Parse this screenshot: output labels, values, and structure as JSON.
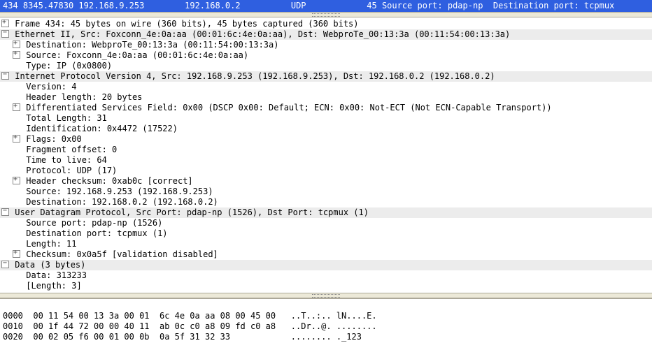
{
  "summary": {
    "no": "434",
    "time": "8345.47830",
    "source": "192.168.9.253",
    "destination": "192.168.0.2",
    "protocol": "UDP",
    "length": "45",
    "info": "Source port: pdap-np  Destination port: tcpmux"
  },
  "frame": "Frame 434: 45 bytes on wire (360 bits), 45 bytes captured (360 bits)",
  "eth": {
    "title": "Ethernet II, Src: Foxconn_4e:0a:aa (00:01:6c:4e:0a:aa), Dst: WebproTe_00:13:3a (00:11:54:00:13:3a)",
    "dst": "Destination: WebproTe_00:13:3a (00:11:54:00:13:3a)",
    "src": "Source: Foxconn_4e:0a:aa (00:01:6c:4e:0a:aa)",
    "type": "Type: IP (0x0800)"
  },
  "ip": {
    "title": "Internet Protocol Version 4, Src: 192.168.9.253 (192.168.9.253), Dst: 192.168.0.2 (192.168.0.2)",
    "version": "Version: 4",
    "hlen": "Header length: 20 bytes",
    "dsf": "Differentiated Services Field: 0x00 (DSCP 0x00: Default; ECN: 0x00: Not-ECT (Not ECN-Capable Transport))",
    "tlen": "Total Length: 31",
    "id": "Identification: 0x4472 (17522)",
    "flags": "Flags: 0x00",
    "frag": "Fragment offset: 0",
    "ttl": "Time to live: 64",
    "proto": "Protocol: UDP (17)",
    "chk": "Header checksum: 0xab0c [correct]",
    "src": "Source: 192.168.9.253 (192.168.9.253)",
    "dst": "Destination: 192.168.0.2 (192.168.0.2)"
  },
  "udp": {
    "title": "User Datagram Protocol, Src Port: pdap-np (1526), Dst Port: tcpmux (1)",
    "sport": "Source port: pdap-np (1526)",
    "dport": "Destination port: tcpmux (1)",
    "len": "Length: 11",
    "chk": "Checksum: 0x0a5f [validation disabled]"
  },
  "data": {
    "title": "Data (3 bytes)",
    "data": "Data: 313233",
    "length": "[Length: 3]"
  },
  "hex": {
    "l0": "0000  00 11 54 00 13 3a 00 01  6c 4e 0a aa 08 00 45 00   ..T..:.. lN....E.",
    "l1": "0010  00 1f 44 72 00 00 40 11  ab 0c c0 a8 09 fd c0 a8   ..Dr..@. ........",
    "l2": "0020  00 02 05 f6 00 01 00 0b  0a 5f 31 32 33            ........ ._123"
  }
}
